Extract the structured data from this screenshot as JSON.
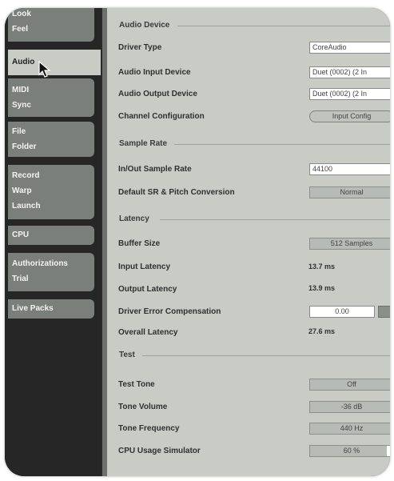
{
  "sidebar": {
    "tabs": [
      {
        "lines": [
          "Look",
          "Feel"
        ]
      },
      {
        "lines": [
          "Audio"
        ]
      },
      {
        "lines": [
          "MIDI",
          "Sync"
        ]
      },
      {
        "lines": [
          "File",
          "Folder"
        ]
      },
      {
        "lines": [
          "Record",
          "Warp",
          "Launch"
        ]
      },
      {
        "lines": [
          "CPU"
        ]
      },
      {
        "lines": [
          "Authorizations",
          "Trial"
        ]
      },
      {
        "lines": [
          "Live Packs"
        ]
      }
    ]
  },
  "audio_device": {
    "section": "Audio Device",
    "driver_type_label": "Driver Type",
    "driver_type_value": "CoreAudio",
    "input_device_label": "Audio Input Device",
    "input_device_value": "Duet (0002) (2 In",
    "output_device_label": "Audio Output Device",
    "output_device_value": "Duet (0002) (2 In",
    "channel_config_label": "Channel Configuration",
    "channel_config_button": "Input Config"
  },
  "sample_rate": {
    "section": "Sample Rate",
    "inout_label": "In/Out Sample Rate",
    "inout_value": "44100",
    "default_sr_label": "Default SR & Pitch Conversion",
    "default_sr_value": "Normal"
  },
  "latency": {
    "section": "Latency",
    "buffer_size_label": "Buffer Size",
    "buffer_size_value": "512 Samples",
    "input_latency_label": "Input Latency",
    "input_latency_value": "13.7 ms",
    "output_latency_label": "Output Latency",
    "output_latency_value": "13.9 ms",
    "driver_error_label": "Driver Error Compensation",
    "driver_error_value": "0.00",
    "overall_latency_label": "Overall Latency",
    "overall_latency_value": "27.6 ms"
  },
  "test": {
    "section": "Test",
    "test_tone_label": "Test Tone",
    "test_tone_value": "Off",
    "tone_volume_label": "Tone Volume",
    "tone_volume_value": "-36 dB",
    "tone_frequency_label": "Tone Frequency",
    "tone_frequency_value": "440 Hz",
    "cpu_sim_label": "CPU Usage Simulator",
    "cpu_sim_value": "60 %",
    "cpu_sim_fraction": 0.6
  },
  "colors": {
    "panel": "#c8ccc5",
    "sidebar": "#262626",
    "tab": "#7b7f7c"
  }
}
